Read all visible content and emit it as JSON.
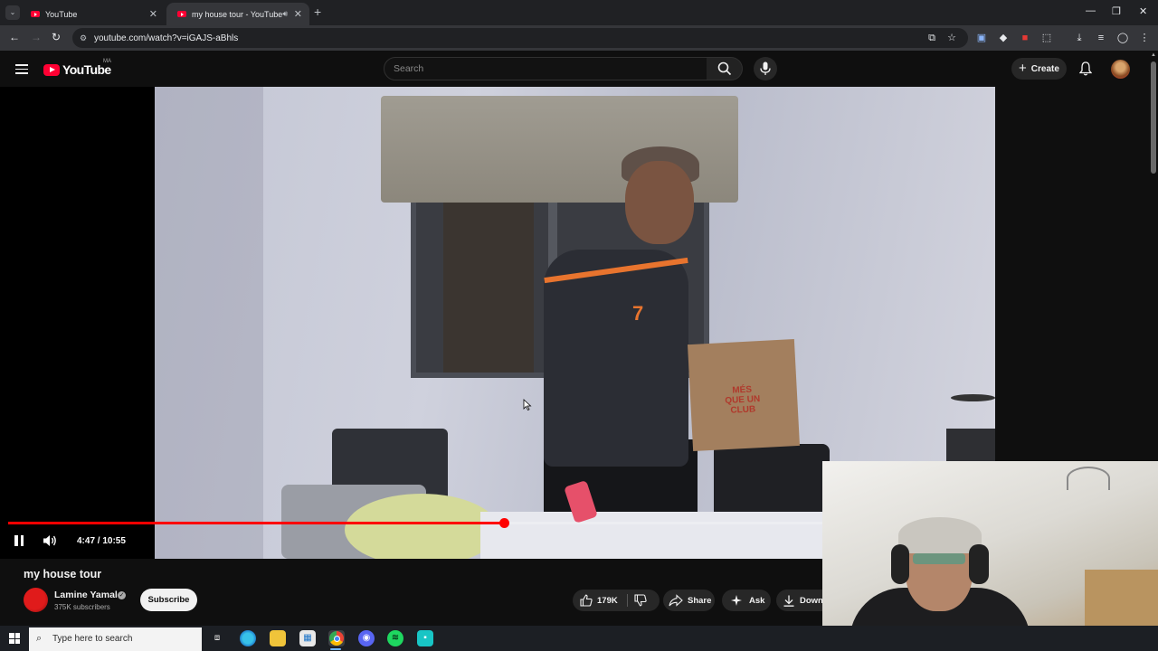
{
  "browser": {
    "tabs": [
      {
        "title": "YouTube",
        "active": false
      },
      {
        "title": "my house tour - YouTube",
        "active": true,
        "audio": true
      }
    ],
    "url": "youtube.com/watch?v=iGAJS-aBhls",
    "new_tab_icon": "plus-icon",
    "window_controls": [
      "minimize-icon",
      "restore-icon",
      "close-icon"
    ],
    "toolbar_icons": [
      "install-app-icon",
      "bookmark-star-icon",
      "translate-icon",
      "extension-diamond-icon",
      "extension-red-icon",
      "extensions-puzzle-icon",
      "downloads-icon",
      "media-controls-icon",
      "profile-icon",
      "menu-kebab-icon"
    ]
  },
  "youtube": {
    "logo_text": "YouTube",
    "country_code": "MA",
    "search_placeholder": "Search",
    "create_label": "Create"
  },
  "player": {
    "time_current": "4:47",
    "time_total": "10:55",
    "time_display": "4:47 / 10:55",
    "progress_fraction": 0.507,
    "state": "playing",
    "bag_text": [
      "MÉS",
      "QUE UN",
      "CLUB"
    ],
    "jersey_number": "7"
  },
  "video": {
    "title": "my house tour",
    "channel_name": "Lamine Yamal",
    "subscribers": "375K subscribers",
    "subscribe_label": "Subscribe",
    "likes": "179K",
    "share_label": "Share",
    "ask_label": "Ask",
    "download_label": "Down"
  },
  "taskbar": {
    "search_placeholder": "Type here to search",
    "apps": [
      "task-view-icon",
      "edge-icon",
      "file-explorer-icon",
      "store-icon",
      "chrome-icon",
      "discord-icon",
      "spotify-icon",
      "app-icon"
    ]
  },
  "colors": {
    "brand_red": "#ff0033",
    "progress_red": "#ff0000",
    "page_bg": "#0f0f0f",
    "chrome_dark": "#202124",
    "chrome_toolbar": "#35363a"
  }
}
